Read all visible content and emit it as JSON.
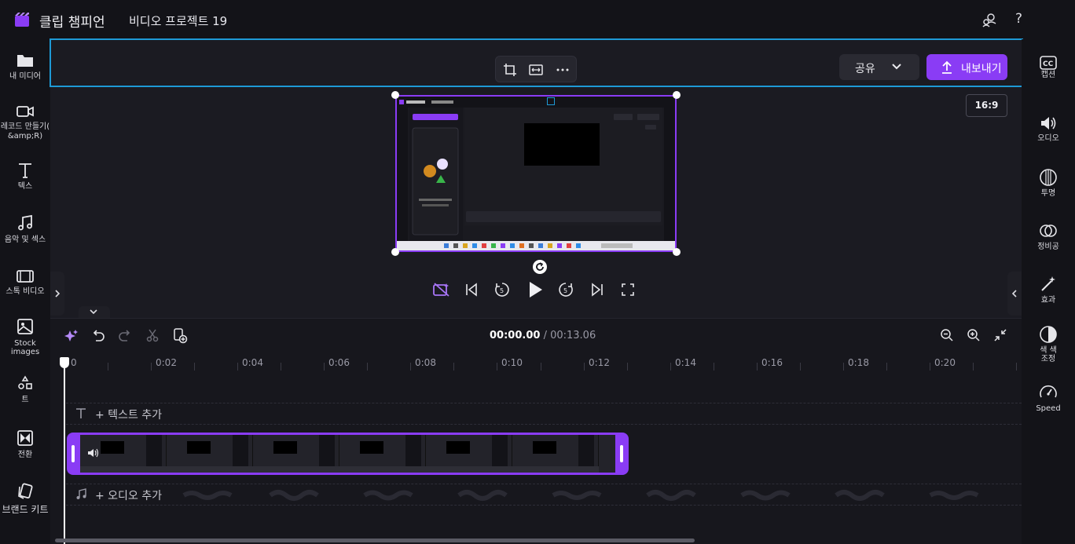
{
  "titlebar": {
    "app_name": "클립 챔피언",
    "project_name": "비디오 프로젝트 19",
    "help_label": "?"
  },
  "left_nav": [
    {
      "id": "media",
      "label": "내 미디어",
      "icon": "folder-icon"
    },
    {
      "id": "record",
      "label": "레코드 만들기(",
      "label2": "&amp;R)",
      "icon": "camera-icon"
    },
    {
      "id": "text",
      "label": "텍스",
      "icon": "text-icon"
    },
    {
      "id": "music",
      "label": "음악 및 섹스",
      "icon": "music-icon"
    },
    {
      "id": "stock-video",
      "label": "스톡 비디오",
      "icon": "film-icon"
    },
    {
      "id": "stock-images",
      "label": "Stock",
      "label2": "images",
      "icon": "image-icon"
    },
    {
      "id": "templates",
      "label": "트",
      "icon": "shapes-icon"
    },
    {
      "id": "transitions",
      "label": "전환",
      "icon": "transition-icon"
    },
    {
      "id": "brand-kit",
      "label": "브랜드 키트",
      "icon": "brand-icon"
    }
  ],
  "right_nav": [
    {
      "id": "captions",
      "label": "캡션",
      "icon": "cc-icon"
    },
    {
      "id": "audio",
      "label": "오디오",
      "icon": "speaker-icon"
    },
    {
      "id": "fade",
      "label": "투명",
      "icon": "fade-icon"
    },
    {
      "id": "filters",
      "label": "정비공",
      "icon": "filter-icon"
    },
    {
      "id": "effects",
      "label": "효과",
      "icon": "wand-icon"
    },
    {
      "id": "color",
      "label": "색 색",
      "label2": "조정",
      "icon": "contrast-icon"
    },
    {
      "id": "speed",
      "label": "Speed",
      "icon": "speedometer-icon"
    }
  ],
  "header": {
    "share_label": "공유",
    "export_label": "내보내기"
  },
  "preview": {
    "aspect_ratio": "16:9"
  },
  "timeline": {
    "current_time": "00:00.00",
    "total_time": "/ 00:13.06",
    "ticks": [
      "0",
      "0:02",
      "0:04",
      "0:06",
      "0:08",
      "0:10",
      "0:12",
      "0:14",
      "0:16",
      "0:18",
      "0:20"
    ],
    "text_track_label": "+ 텍스트 추가",
    "audio_track_label": "+ 오디오 추가"
  }
}
